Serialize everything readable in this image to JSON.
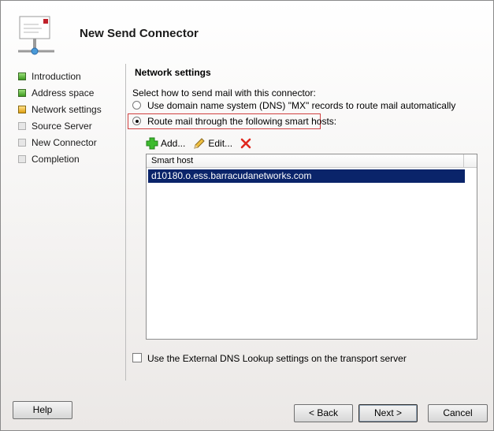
{
  "wizard": {
    "title": "New Send Connector",
    "steps": [
      {
        "label": "Introduction",
        "state": "done"
      },
      {
        "label": "Address space",
        "state": "done"
      },
      {
        "label": "Network settings",
        "state": "current"
      },
      {
        "label": "Source Server",
        "state": "todo"
      },
      {
        "label": "New Connector",
        "state": "todo"
      },
      {
        "label": "Completion",
        "state": "todo"
      }
    ]
  },
  "main": {
    "section_title": "Network settings",
    "instruction": "Select how to send mail with this connector:",
    "options": [
      {
        "label": "Use domain name system (DNS) \"MX\" records to route mail automatically",
        "selected": false
      },
      {
        "label": "Route mail through the following smart hosts:",
        "selected": true
      }
    ],
    "toolbar": {
      "add_label": "Add...",
      "edit_label": "Edit..."
    },
    "list": {
      "column_header": "Smart host",
      "rows": [
        "d10180.o.ess.barracudanetworks.com"
      ]
    },
    "external_dns": {
      "label": "Use the External DNS Lookup settings on the transport server",
      "checked": false
    }
  },
  "buttons": {
    "help": "Help",
    "back": "< Back",
    "next": "Next >",
    "cancel": "Cancel"
  },
  "colors": {
    "selection": "#0a246a",
    "highlight_border": "#d04040",
    "step_done": "#3c9a1e",
    "step_current": "#e0a010"
  },
  "icons": {
    "header": "mail-connector-icon",
    "add": "plus-icon",
    "edit": "pencil-icon",
    "remove": "x-icon"
  }
}
